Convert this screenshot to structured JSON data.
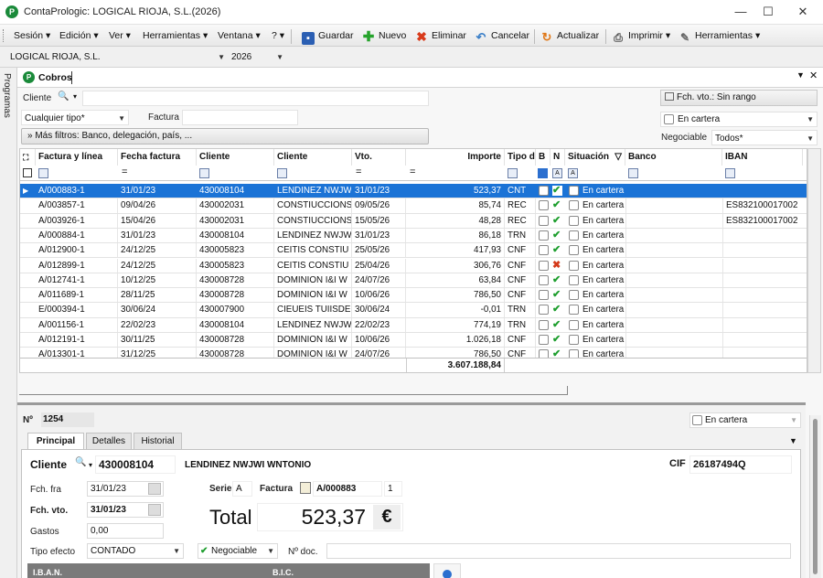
{
  "window": {
    "title": "ContaPrologic: LOGICAL RIOJA, S.L.(2026)",
    "logo": "P"
  },
  "menu": [
    "Sesión",
    "Edición",
    "Ver",
    "Herramientas",
    "Ventana",
    "?"
  ],
  "toolbar": {
    "guardar": "Guardar",
    "nuevo": "Nuevo",
    "eliminar": "Eliminar",
    "cancelar": "Cancelar",
    "actualizar": "Actualizar",
    "imprimir": "Imprimir",
    "herramientas": "Herramientas"
  },
  "company": {
    "name": "LOGICAL RIOJA, S.L.",
    "year": "2026"
  },
  "sidebar": {
    "label": "Programas"
  },
  "tab": {
    "title": "Cobros"
  },
  "filters": {
    "cliente_label": "Cliente",
    "tipo_value": "Cualquier tipo*",
    "factura_label": "Factura",
    "more_filters": "Más filtros: Banco, delegación, país, ...",
    "fch_vto": "Fch. vto.: Sin rango",
    "en_cartera": "En cartera",
    "negociable_label": "Negociable",
    "negociable_value": "Todos*"
  },
  "columns": [
    "Factura y línea",
    "Fecha factura",
    "Cliente",
    "Cliente",
    "Vto.",
    "Importe",
    "Tipo d",
    "B",
    "N",
    "Situación",
    "Banco",
    "IBAN"
  ],
  "rows": [
    {
      "factura": "A/000883-1",
      "fecha": "31/01/23",
      "cod": "430008104",
      "cliente": "LENDINEZ NWJW",
      "vto": "31/01/23",
      "importe": "523,37",
      "tipo": "CNT",
      "n": "ok",
      "situacion": "En cartera",
      "iban": ""
    },
    {
      "factura": "A/003857-1",
      "fecha": "09/04/26",
      "cod": "430002031",
      "cliente": "CONSTIUCCIONS",
      "vto": "09/05/26",
      "importe": "85,74",
      "tipo": "REC",
      "n": "ok",
      "situacion": "En cartera",
      "iban": "ES832100017002"
    },
    {
      "factura": "A/003926-1",
      "fecha": "15/04/26",
      "cod": "430002031",
      "cliente": "CONSTIUCCIONS",
      "vto": "15/05/26",
      "importe": "48,28",
      "tipo": "REC",
      "n": "ok",
      "situacion": "En cartera",
      "iban": "ES832100017002"
    },
    {
      "factura": "A/000884-1",
      "fecha": "31/01/23",
      "cod": "430008104",
      "cliente": "LENDINEZ NWJW",
      "vto": "31/01/23",
      "importe": "86,18",
      "tipo": "TRN",
      "n": "ok",
      "situacion": "En cartera",
      "iban": ""
    },
    {
      "factura": "A/012900-1",
      "fecha": "24/12/25",
      "cod": "430005823",
      "cliente": "CEITIS CONSTIU",
      "vto": "25/05/26",
      "importe": "417,93",
      "tipo": "CNF",
      "n": "ok",
      "situacion": "En cartera",
      "iban": ""
    },
    {
      "factura": "A/012899-1",
      "fecha": "24/12/25",
      "cod": "430005823",
      "cliente": "CEITIS CONSTIU",
      "vto": "25/04/26",
      "importe": "306,76",
      "tipo": "CNF",
      "n": "x",
      "situacion": "En cartera",
      "iban": ""
    },
    {
      "factura": "A/012741-1",
      "fecha": "10/12/25",
      "cod": "430008728",
      "cliente": "DOMINION I&I W",
      "vto": "24/07/26",
      "importe": "63,84",
      "tipo": "CNF",
      "n": "ok",
      "situacion": "En cartera",
      "iban": ""
    },
    {
      "factura": "A/011689-1",
      "fecha": "28/11/25",
      "cod": "430008728",
      "cliente": "DOMINION I&I W",
      "vto": "10/06/26",
      "importe": "786,50",
      "tipo": "CNF",
      "n": "ok",
      "situacion": "En cartera",
      "iban": ""
    },
    {
      "factura": "E/000394-1",
      "fecha": "30/06/24",
      "cod": "430007900",
      "cliente": "CIEUEIS TUIISDE",
      "vto": "30/06/24",
      "importe": "-0,01",
      "tipo": "TRN",
      "n": "ok",
      "situacion": "En cartera",
      "iban": ""
    },
    {
      "factura": "A/001156-1",
      "fecha": "22/02/23",
      "cod": "430008104",
      "cliente": "LENDINEZ NWJW",
      "vto": "22/02/23",
      "importe": "774,19",
      "tipo": "TRN",
      "n": "ok",
      "situacion": "En cartera",
      "iban": ""
    },
    {
      "factura": "A/012191-1",
      "fecha": "30/11/25",
      "cod": "430008728",
      "cliente": "DOMINION I&I W",
      "vto": "10/06/26",
      "importe": "1.026,18",
      "tipo": "CNF",
      "n": "ok",
      "situacion": "En cartera",
      "iban": ""
    },
    {
      "factura": "A/013301-1",
      "fecha": "31/12/25",
      "cod": "430008728",
      "cliente": "DOMINION I&I W",
      "vto": "24/07/26",
      "importe": "786,50",
      "tipo": "CNF",
      "n": "ok",
      "situacion": "En cartera",
      "iban": ""
    }
  ],
  "total_sum": "3.607.188,84",
  "detail": {
    "no_label": "Nº",
    "no_value": "1254",
    "en_cartera": "En cartera",
    "tabs": [
      "Principal",
      "Detalles",
      "Historial"
    ],
    "cliente_label": "Cliente",
    "cliente_code": "430008104",
    "cliente_name": "LENDINEZ NWJWI WNTONIO",
    "cif_label": "CIF",
    "cif_value": "26187494Q",
    "fch_fra_label": "Fch. fra",
    "fch_fra": "31/01/23",
    "fch_vto_label": "Fch. vto.",
    "fch_vto": "31/01/23",
    "serie_label": "Serie",
    "serie": "A",
    "factura_label": "Factura",
    "factura": "A/000883",
    "factura_line": "1",
    "total_label": "Total",
    "total": "523,37",
    "currency": "€",
    "gastos_label": "Gastos",
    "gastos": "0,00",
    "tipo_efecto_label": "Tipo efecto",
    "tipo_efecto": "CONTADO",
    "negociable": "Negociable",
    "ndoc_label": "Nº doc.",
    "iban_label": "I.B.A.N.",
    "bic_label": "B.I.C."
  }
}
